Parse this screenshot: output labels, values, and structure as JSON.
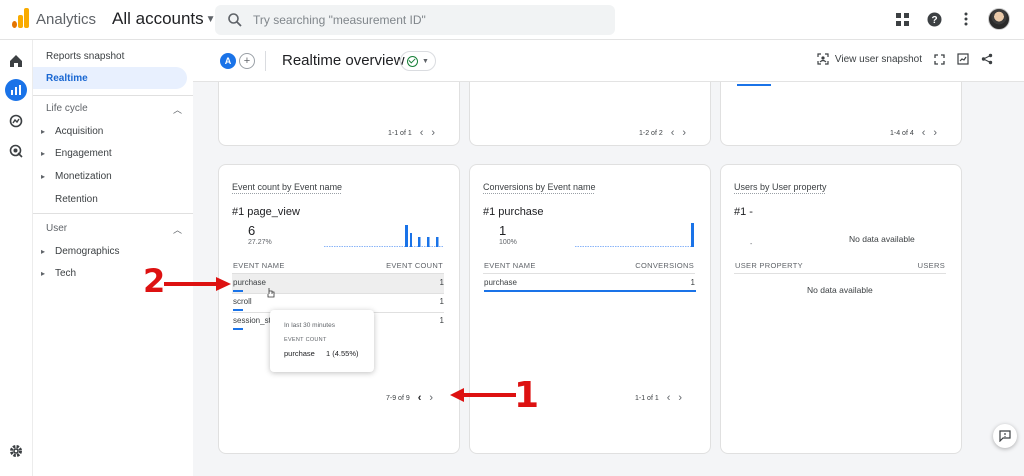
{
  "topbar": {
    "app_name": "Analytics",
    "account_selector": "All accounts",
    "search_placeholder": "Try searching \"measurement ID\"",
    "icons": [
      "apps-grid-icon",
      "help-icon",
      "more-vert-icon",
      "account-avatar"
    ]
  },
  "rail": {
    "icons": [
      "home-icon",
      "reports-icon",
      "explore-icon",
      "advertising-icon",
      "settings-icon"
    ],
    "active": "reports-icon"
  },
  "nav": {
    "reports_snapshot": "Reports snapshot",
    "realtime": "Realtime",
    "lifecycle_section": "Life cycle",
    "lifecycle_items": [
      "Acquisition",
      "Engagement",
      "Monetization",
      "Retention"
    ],
    "user_section": "User",
    "user_items": [
      "Demographics",
      "Tech"
    ]
  },
  "subheader": {
    "chip_letter": "A",
    "title": "Realtime overview",
    "view_snapshot": "View user snapshot"
  },
  "top_cards": [
    {
      "pager": "1-1 of 1"
    },
    {
      "pager": "1-2 of 2"
    },
    {
      "pager": "1-4 of 4"
    }
  ],
  "cards": {
    "events": {
      "title": "Event count by Event name",
      "rank": "#1  page_view",
      "value": "6",
      "pct": "27.27%",
      "col_left": "EVENT NAME",
      "col_right": "EVENT COUNT",
      "rows": [
        {
          "name": "purchase",
          "value": "1"
        },
        {
          "name": "scroll",
          "value": "1"
        },
        {
          "name": "session_st",
          "value": "1"
        }
      ],
      "pager": "7-9 of 9"
    },
    "conversions": {
      "title": "Conversions by Event name",
      "rank": "#1  purchase",
      "value": "1",
      "pct": "100%",
      "col_left": "EVENT NAME",
      "col_right": "CONVERSIONS",
      "rows": [
        {
          "name": "purchase",
          "value": "1"
        }
      ],
      "pager": "1-1 of 1"
    },
    "users": {
      "title": "Users by User property",
      "rank": "#1  -",
      "dash": "-",
      "no_data_top": "No data available",
      "col_left": "USER PROPERTY",
      "col_right": "USERS",
      "no_data_table": "No data available"
    }
  },
  "tooltip": {
    "period": "In last 30 minutes",
    "metric": "EVENT COUNT",
    "name": "purchase",
    "value": "1 (4.55%)"
  },
  "annotations": {
    "step1": "1",
    "step2": "2",
    "color": "#dd1111"
  },
  "colors": {
    "accent": "#1a73e8",
    "logo_orange": "#f9ab00",
    "logo_dark": "#e37400"
  }
}
